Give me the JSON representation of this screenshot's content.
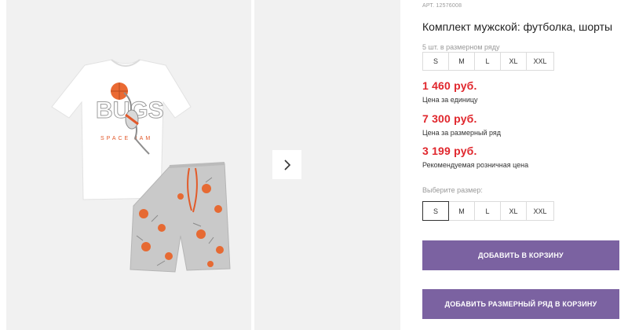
{
  "product": {
    "article": "АРТ. 12576008",
    "title": "Комплект мужской: футболка, шорты"
  },
  "pack": {
    "label": "5 шт. в размерном ряду",
    "sizes": [
      "S",
      "M",
      "L",
      "XL",
      "XXL"
    ]
  },
  "prices": [
    {
      "value": "1 460 руб.",
      "note": "Цена за единицу"
    },
    {
      "value": "7 300 руб.",
      "note": "Цена за размерный ряд"
    },
    {
      "value": "3 199 руб.",
      "note": "Рекомендуемая розничная цена"
    }
  ],
  "size_picker": {
    "label": "Выберите размер:",
    "sizes": [
      "S",
      "M",
      "L",
      "XL",
      "XXL"
    ],
    "selected": "S"
  },
  "buttons": {
    "add_to_cart": "ДОБАВИТЬ В КОРЗИНУ",
    "add_pack_to_cart": "ДОБАВИТЬ РАЗМЕРНЫЙ РЯД В КОРЗИНУ"
  },
  "icons": {
    "next": "chevron-right-icon"
  },
  "colors": {
    "accent": "#7b62a1",
    "price": "#e0262c",
    "panel_bg": "#f1f1f1"
  }
}
